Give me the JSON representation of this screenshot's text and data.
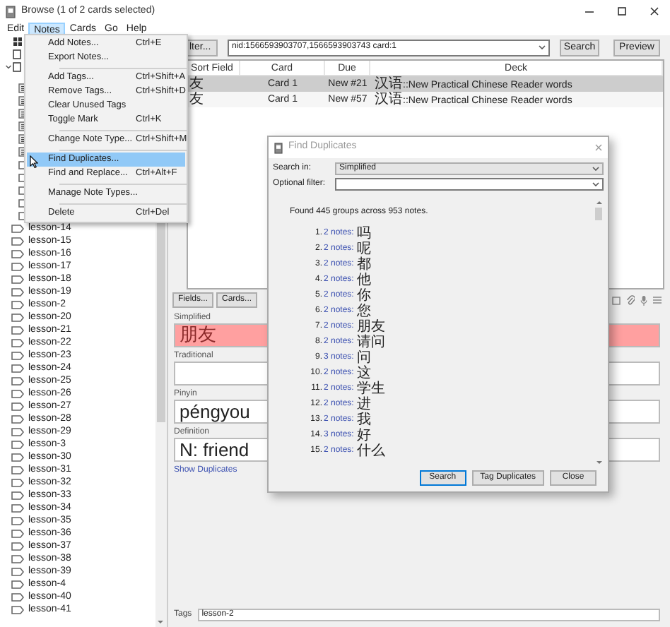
{
  "window": {
    "title": "Browse (1 of 2 cards selected)"
  },
  "menu_bar": [
    {
      "label": "Edit",
      "selected": false
    },
    {
      "label": "Notes",
      "selected": true
    },
    {
      "label": "Cards",
      "selected": false
    },
    {
      "label": "Go",
      "selected": false
    },
    {
      "label": "Help",
      "selected": false
    }
  ],
  "notes_menu": [
    {
      "kind": "item",
      "label": "Add Notes...",
      "shortcut": "Ctrl+E",
      "selected": false
    },
    {
      "kind": "item",
      "label": "Export Notes...",
      "selected": false
    },
    {
      "kind": "separator"
    },
    {
      "kind": "item",
      "label": "Add Tags...",
      "shortcut": "Ctrl+Shift+A",
      "selected": false
    },
    {
      "kind": "item",
      "label": "Remove Tags...",
      "shortcut": "Ctrl+Shift+D",
      "selected": false
    },
    {
      "kind": "item",
      "label": "Clear Unused Tags",
      "selected": false
    },
    {
      "kind": "item",
      "label": "Toggle Mark",
      "shortcut": "Ctrl+K",
      "selected": false
    },
    {
      "kind": "separator"
    },
    {
      "kind": "item",
      "label": "Change Note Type...",
      "shortcut": "Ctrl+Shift+M",
      "selected": false
    },
    {
      "kind": "separator"
    },
    {
      "kind": "item",
      "label": "Find Duplicates...",
      "selected": true
    },
    {
      "kind": "item",
      "label": "Find and Replace...",
      "shortcut": "Ctrl+Alt+F",
      "selected": false
    },
    {
      "kind": "separator"
    },
    {
      "kind": "item",
      "label": "Manage Note Types...",
      "selected": false
    },
    {
      "kind": "separator"
    },
    {
      "kind": "item",
      "label": "Delete",
      "shortcut": "Ctrl+Del",
      "selected": false
    }
  ],
  "sidebar": {
    "items": [
      "lesson-14",
      "lesson-15",
      "lesson-16",
      "lesson-17",
      "lesson-18",
      "lesson-19",
      "lesson-2",
      "lesson-20",
      "lesson-21",
      "lesson-22",
      "lesson-23",
      "lesson-24",
      "lesson-25",
      "lesson-26",
      "lesson-27",
      "lesson-28",
      "lesson-29",
      "lesson-3",
      "lesson-30",
      "lesson-31",
      "lesson-32",
      "lesson-33",
      "lesson-34",
      "lesson-35",
      "lesson-36",
      "lesson-37",
      "lesson-38",
      "lesson-39",
      "lesson-4",
      "lesson-40",
      "lesson-41"
    ]
  },
  "toolbar": {
    "filter_button": "lter...",
    "search_value": "nid:1566593903707,1566593903743 card:1",
    "search_button": "Search",
    "preview_button": "Preview"
  },
  "table": {
    "columns": [
      "Sort Field",
      "Card",
      "Due",
      "Deck"
    ],
    "rows": [
      {
        "sort_field": "友",
        "card": "Card 1",
        "due": "New #21",
        "deck": "汉语::New Practical Chinese Reader words",
        "selected": true
      },
      {
        "sort_field": "友",
        "card": "Card 1",
        "due": "New #57",
        "deck": "汉语::New Practical Chinese Reader words",
        "selected": false
      }
    ]
  },
  "editor": {
    "buttons": [
      "Fields...",
      "Cards..."
    ],
    "fields": [
      {
        "label": "Simplified",
        "value": "朋友",
        "duplicate": true
      },
      {
        "label": "Traditional",
        "duplicate": false
      },
      {
        "label": "Pinyin",
        "value": "péngyou",
        "duplicate": false
      },
      {
        "label": "Definition",
        "value": "N: friend",
        "duplicate": false
      }
    ],
    "show_duplicates": "Show Duplicates",
    "tags_label": "Tags",
    "tags_value": "lesson-2"
  },
  "dialog": {
    "title": "Find Duplicates",
    "search_in_label": "Search in:",
    "search_in_value": "Simplified",
    "filter_label": "Optional filter:",
    "summary": "Found 445 groups across 953 notes.",
    "results": [
      {
        "number": "1.",
        "link": "2 notes:",
        "text": "吗"
      },
      {
        "number": "2.",
        "link": "2 notes:",
        "text": "呢"
      },
      {
        "number": "3.",
        "link": "2 notes:",
        "text": "都"
      },
      {
        "number": "4.",
        "link": "2 notes:",
        "text": "他"
      },
      {
        "number": "5.",
        "link": "2 notes:",
        "text": "你"
      },
      {
        "number": "6.",
        "link": "2 notes:",
        "text": "您"
      },
      {
        "number": "7.",
        "link": "2 notes:",
        "text": "朋友"
      },
      {
        "number": "8.",
        "link": "2 notes:",
        "text": "请问"
      },
      {
        "number": "9.",
        "link": "3 notes:",
        "text": "问"
      },
      {
        "number": "10.",
        "link": "2 notes:",
        "text": "这"
      },
      {
        "number": "11.",
        "link": "2 notes:",
        "text": "学生"
      },
      {
        "number": "12.",
        "link": "2 notes:",
        "text": "进"
      },
      {
        "number": "13.",
        "link": "2 notes:",
        "text": "我"
      },
      {
        "number": "14.",
        "link": "3 notes:",
        "text": "好"
      },
      {
        "number": "15.",
        "link": "2 notes:",
        "text": "什么"
      }
    ],
    "buttons": [
      {
        "label": "Search",
        "focused": true
      },
      {
        "label": "Tag Duplicates",
        "focused": false
      },
      {
        "label": "Close",
        "focused": false
      }
    ]
  }
}
